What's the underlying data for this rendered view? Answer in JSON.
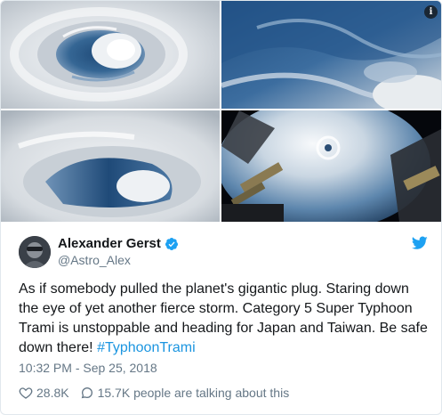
{
  "media": {
    "info_badge": "i",
    "images": [
      {
        "icon": "typhoon-eye-closeup"
      },
      {
        "icon": "cloud-swirl-closeup"
      },
      {
        "icon": "typhoon-eye-oblique"
      },
      {
        "icon": "space-station-view"
      }
    ]
  },
  "author": {
    "name": "Alexander Gerst",
    "handle": "@Astro_Alex",
    "verified": true
  },
  "tweet": {
    "text": "As if somebody pulled the planet's gigantic plug. Staring down the eye of yet another fierce storm. Category 5 Super Typhoon Trami is unstoppable and heading for Japan and Taiwan. Be safe down there! ",
    "hashtag": "#TyphoonTrami",
    "timestamp": "10:32 PM - Sep 25, 2018"
  },
  "actions": {
    "likes": "28.8K",
    "replies": "15.7K people are talking about this"
  },
  "colors": {
    "text": "#14171a",
    "secondary": "#657786",
    "link": "#1b95e0",
    "brand": "#1da1f2",
    "border": "#e1e8ed"
  }
}
